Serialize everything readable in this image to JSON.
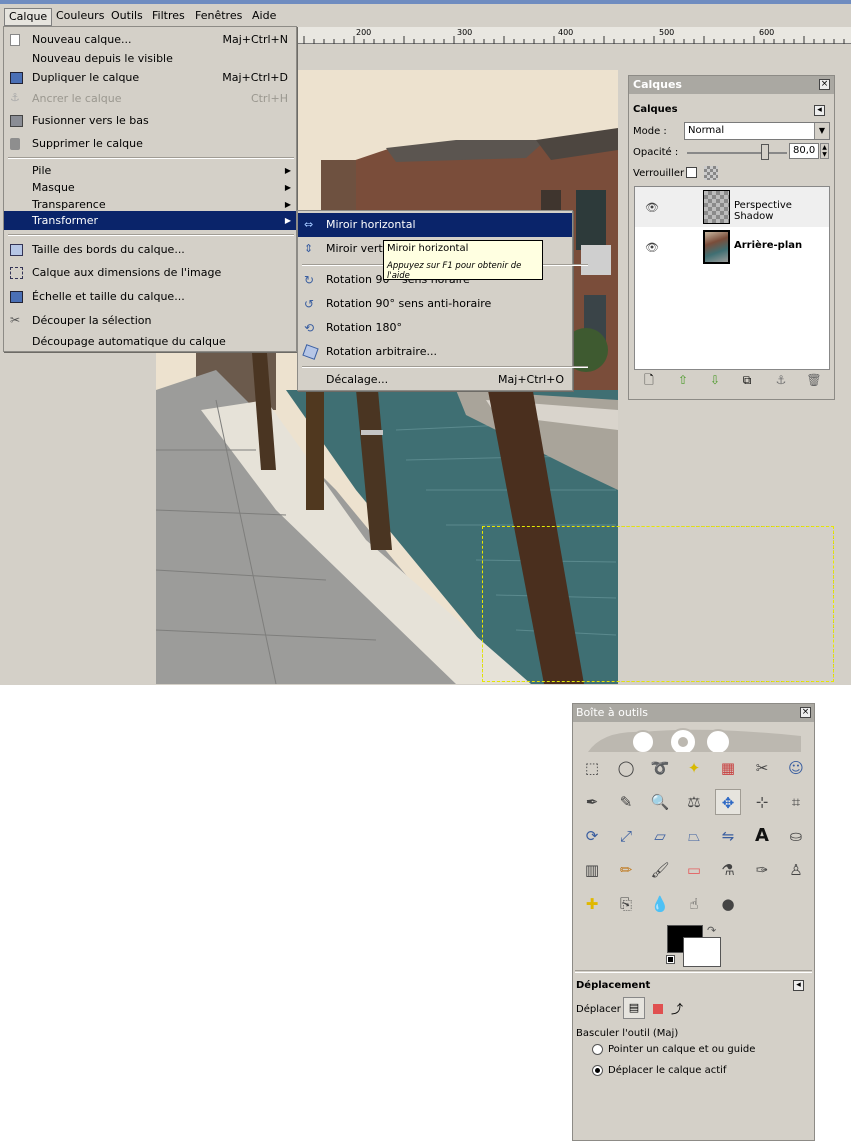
{
  "menubar": {
    "items": [
      "Calque",
      "Couleurs",
      "Outils",
      "Filtres",
      "Fenêtres",
      "Aide"
    ],
    "active": "Calque"
  },
  "ruler": {
    "ticks": [
      "200",
      "300",
      "400",
      "500",
      "600"
    ]
  },
  "layer_menu": {
    "items": [
      {
        "label": "Nouveau calque...",
        "accel": "Maj+Ctrl+N",
        "icon": "new-layer-icon"
      },
      {
        "label": "Nouveau depuis le visible",
        "accel": "",
        "icon": ""
      },
      {
        "label": "Dupliquer le calque",
        "accel": "Maj+Ctrl+D",
        "icon": "duplicate-icon"
      },
      {
        "label": "Ancrer le calque",
        "accel": "Ctrl+H",
        "icon": "anchor-icon",
        "disabled": true
      },
      {
        "label": "Fusionner vers le bas",
        "accel": "",
        "icon": "merge-down-icon"
      },
      {
        "label": "Supprimer le calque",
        "accel": "",
        "icon": "trash-icon"
      },
      {
        "label": "Pile",
        "submenu": true
      },
      {
        "label": "Masque",
        "submenu": true
      },
      {
        "label": "Transparence",
        "submenu": true
      },
      {
        "label": "Transformer",
        "submenu": true,
        "selected": true
      },
      {
        "label": "Taille des bords du calque...",
        "icon": "layer-boundary-icon"
      },
      {
        "label": "Calque aux dimensions de l'image",
        "icon": "fit-image-icon"
      },
      {
        "label": "Échelle et taille du calque...",
        "icon": "scale-icon"
      },
      {
        "label": "Découper la sélection",
        "icon": "crop-icon"
      },
      {
        "label": "Découpage automatique du calque",
        "icon": ""
      }
    ]
  },
  "transform_menu": {
    "items": [
      {
        "label": "Miroir horizontal",
        "accel": "",
        "icon": "flip-horizontal-icon",
        "selected": true
      },
      {
        "label": "Miroir vertical",
        "accel": "",
        "icon": "flip-vertical-icon"
      },
      {
        "label": "Rotation 90° sens horaire",
        "accel": "",
        "icon": "rotate-cw-icon"
      },
      {
        "label": "Rotation 90° sens anti-horaire",
        "accel": "",
        "icon": "rotate-ccw-icon"
      },
      {
        "label": "Rotation 180°",
        "accel": "",
        "icon": "rotate-180-icon"
      },
      {
        "label": "Rotation arbitraire...",
        "accel": "",
        "icon": "rotate-arbitrary-icon"
      },
      {
        "label": "Décalage...",
        "accel": "Maj+Ctrl+O",
        "icon": ""
      }
    ],
    "visible_labels": {
      "miroir_vertical": "Miroir vertic",
      "rotation_cw": "Rotation 90°",
      "rotation_cw_tail": "sens horaire"
    }
  },
  "tooltip": {
    "title": "Miroir horizontal",
    "hint": "Appuyez sur F1 pour obtenir de l'aide"
  },
  "layers_dock": {
    "window_title": "Calques",
    "section_title": "Calques",
    "mode_label": "Mode :",
    "mode_value": "Normal",
    "opacity_label": "Opacité :",
    "opacity_value": "80,0",
    "opacity_fraction": 0.8,
    "lock_label": "Verrouiller :",
    "layers": [
      {
        "name": "Perspective Shadow",
        "bold": false
      },
      {
        "name": "Arrière-plan",
        "bold": true
      }
    ]
  },
  "toolbox": {
    "title": "Boîte à outils",
    "tools": [
      "rect-select-icon",
      "ellipse-select-icon",
      "lasso-icon",
      "fuzzy-select-icon",
      "color-select-icon",
      "scissors-icon",
      "foreground-select-icon",
      "paths-icon",
      "color-picker-icon",
      "zoom-icon",
      "measure-icon",
      "move-icon",
      "align-icon",
      "crop-icon",
      "rotate-icon",
      "scale-icon",
      "shear-icon",
      "perspective-icon",
      "flip-icon",
      "text-icon",
      "bucket-fill-icon",
      "blend-icon",
      "pencil-icon",
      "paintbrush-icon",
      "eraser-icon",
      "airbrush-icon",
      "ink-icon",
      "clone-icon",
      "heal-icon",
      "perspective-clone-icon",
      "blur-icon",
      "smudge-icon",
      "dodge-burn-icon"
    ],
    "active_tool": "move-icon",
    "colors": {
      "foreground": "#000000",
      "background": "#ffffff"
    },
    "options_title": "Déplacement",
    "move_label": "Déplacer :",
    "toggle_label": "Basculer l'outil  (Maj)",
    "radio_options": [
      {
        "label": "Pointer un calque et ou guide",
        "checked": false
      },
      {
        "label": "Déplacer le calque actif",
        "checked": true
      }
    ]
  },
  "colors": {
    "menu_bg": "#d4d0c8",
    "selection": "#0a246a",
    "tooltip_bg": "#ffffe1"
  }
}
